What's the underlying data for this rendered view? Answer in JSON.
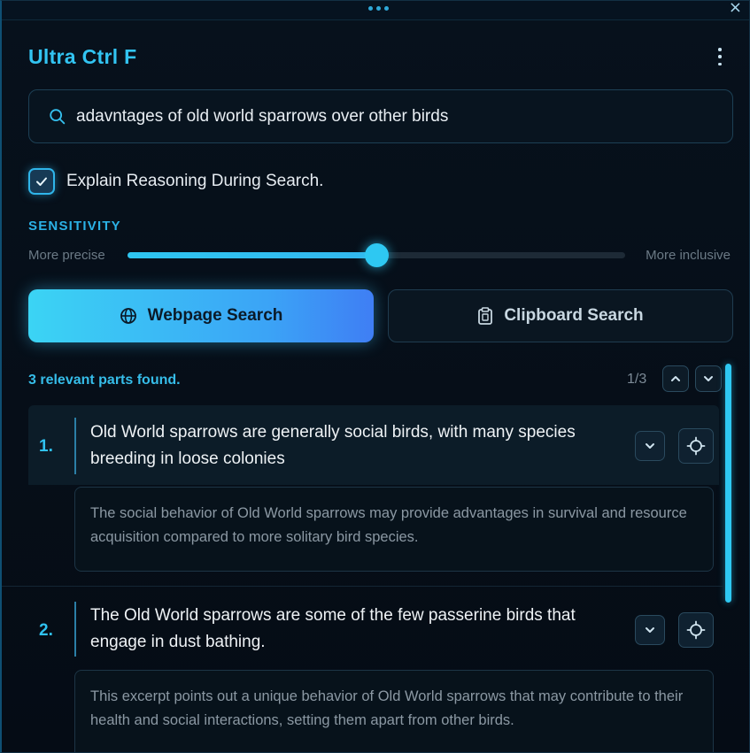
{
  "app": {
    "title": "Ultra Ctrl F",
    "close_glyph": "×"
  },
  "search": {
    "value": "adavntages of old world sparrows over other birds",
    "placeholder": ""
  },
  "options": {
    "explain_label": "Explain Reasoning During Search.",
    "explain_checked": true
  },
  "sensitivity": {
    "title": "SENSITIVITY",
    "min_label": "More precise",
    "max_label": "More inclusive",
    "value_fraction": 0.5
  },
  "buttons": {
    "webpage_label": "Webpage Search",
    "clipboard_label": "Clipboard Search"
  },
  "results": {
    "count_text": "3 relevant parts found.",
    "pager_text": "1/3",
    "items": [
      {
        "number": "1.",
        "text": "Old World sparrows are generally social birds, with many species breeding in loose colonies",
        "explanation": "The social behavior of Old World sparrows may provide advantages in survival and resource acquisition compared to more solitary bird species."
      },
      {
        "number": "2.",
        "text": "The Old World sparrows are some of the few passerine birds that engage in dust bathing.",
        "explanation": "This excerpt points out a unique behavior of Old World sparrows that may contribute to their health and social interactions, setting them apart from other birds."
      }
    ]
  },
  "colors": {
    "accent": "#32c4f2",
    "background": "#07111c",
    "button_gradient_start": "#3bd4f4",
    "button_gradient_end": "#3f7ef4"
  }
}
